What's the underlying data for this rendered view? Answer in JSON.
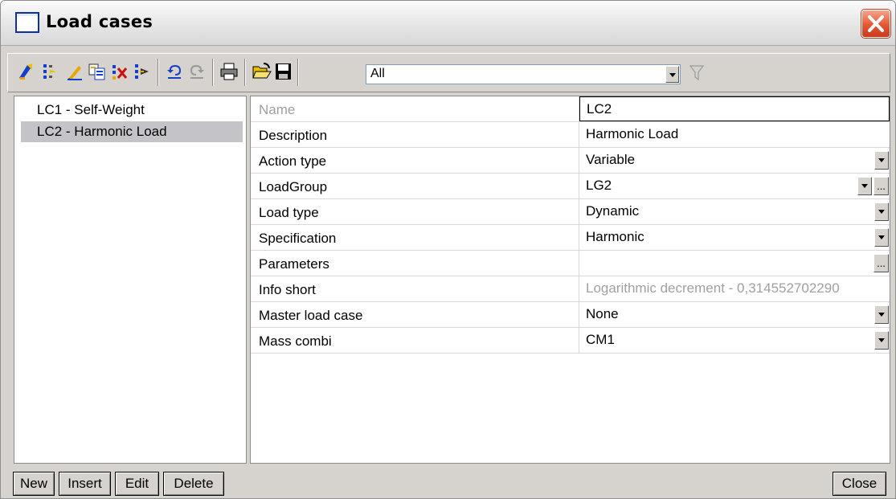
{
  "window": {
    "title": "Load cases",
    "close_icon": "close-icon"
  },
  "toolbar": {
    "filter_value": "All",
    "icons": [
      "new-case-icon",
      "insert-icon",
      "edit-icon",
      "copy-icon",
      "delete-icon",
      "export-icon",
      "undo-icon",
      "redo-icon",
      "print-icon",
      "open-icon",
      "save-icon",
      "filter-icon"
    ]
  },
  "load_cases": [
    {
      "label": "LC1 - Self-Weight",
      "selected": false
    },
    {
      "label": "LC2 - Harmonic Load",
      "selected": true
    }
  ],
  "properties": [
    {
      "name": "Name",
      "value": "LC2",
      "control": "text"
    },
    {
      "name": "Description",
      "value": "Harmonic Load",
      "control": "text"
    },
    {
      "name": "Action type",
      "value": "Variable",
      "control": "dropdown"
    },
    {
      "name": "LoadGroup",
      "value": "LG2",
      "control": "dropdown-ellipsis"
    },
    {
      "name": "Load type",
      "value": "Dynamic",
      "control": "dropdown"
    },
    {
      "name": "Specification",
      "value": "Harmonic",
      "control": "dropdown"
    },
    {
      "name": "Parameters",
      "value": "",
      "control": "ellipsis"
    },
    {
      "name": "Info short",
      "value": "Logarithmic decrement - 0,314552702290",
      "control": "readonly"
    },
    {
      "name": "Master load case",
      "value": "None",
      "control": "dropdown"
    },
    {
      "name": "Mass combi",
      "value": "CM1",
      "control": "dropdown"
    }
  ],
  "ellipsis_label": "...",
  "buttons": {
    "new": "New",
    "insert": "Insert",
    "edit": "Edit",
    "delete": "Delete",
    "close": "Close"
  },
  "colors": {
    "selection": "#c4c3c8",
    "readonly_text": "#a0a0a0",
    "close_red": "#e35833"
  }
}
